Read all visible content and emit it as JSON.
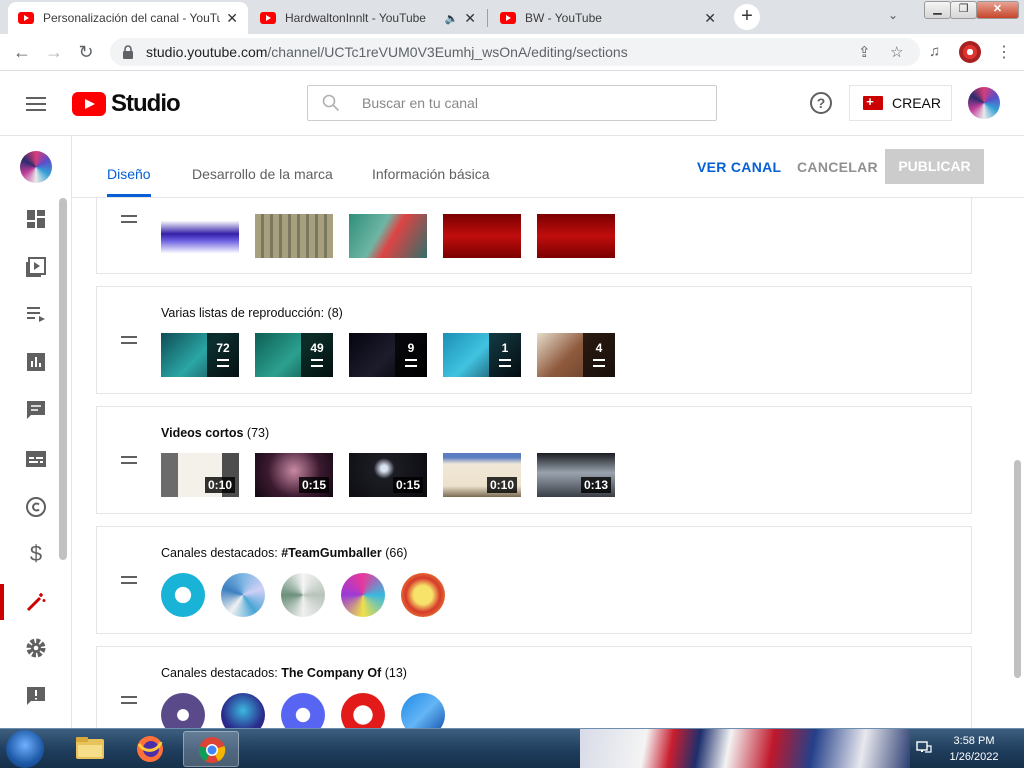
{
  "browser": {
    "tabs": [
      {
        "title": "Personalización del canal - YouTube",
        "active": true
      },
      {
        "title": "HardwaltonInnlt - YouTube",
        "active": false,
        "audio": true
      },
      {
        "title": "BW - YouTube",
        "active": false
      }
    ],
    "new_tab_label": "+",
    "url_host": "studio.youtube.com",
    "url_path": "/channel/UCTc1reVUM0V3Eumhj_wsOnA/editing/sections"
  },
  "header": {
    "logo_text": "Studio",
    "search_placeholder": "Buscar en tu canal",
    "help_label": "?",
    "create_label": "CREAR"
  },
  "editor_tabs": [
    {
      "label": "Diseño",
      "active": true
    },
    {
      "label": "Desarrollo de la marca",
      "active": false
    },
    {
      "label": "Información básica",
      "active": false
    }
  ],
  "actions": {
    "view_channel": "VER CANAL",
    "cancel": "CANCELAR",
    "publish": "PUBLICAR"
  },
  "sections": [
    {
      "title_prefix": "Varias listas de reproducción:",
      "title_bold": "",
      "count": "(8)",
      "playlist_counts": [
        "72",
        "49",
        "9",
        "1",
        "4"
      ]
    },
    {
      "title_prefix": "",
      "title_bold": "Videos cortos",
      "count": "(73)",
      "durations": [
        "0:10",
        "0:15",
        "0:15",
        "0:10",
        "0:13"
      ]
    },
    {
      "title_prefix": "Canales destacados:",
      "title_bold": "#TeamGumballer",
      "count": "(66)"
    },
    {
      "title_prefix": "Canales destacados:",
      "title_bold": "The Company Of",
      "count": "(13)"
    }
  ],
  "taskbar": {
    "time": "3:58 PM",
    "date": "1/26/2022"
  },
  "colors": {
    "accent": "#065fd4",
    "brand_red": "#ff0000",
    "create_red": "#cc0000",
    "publish_disabled": "#cccccc"
  }
}
